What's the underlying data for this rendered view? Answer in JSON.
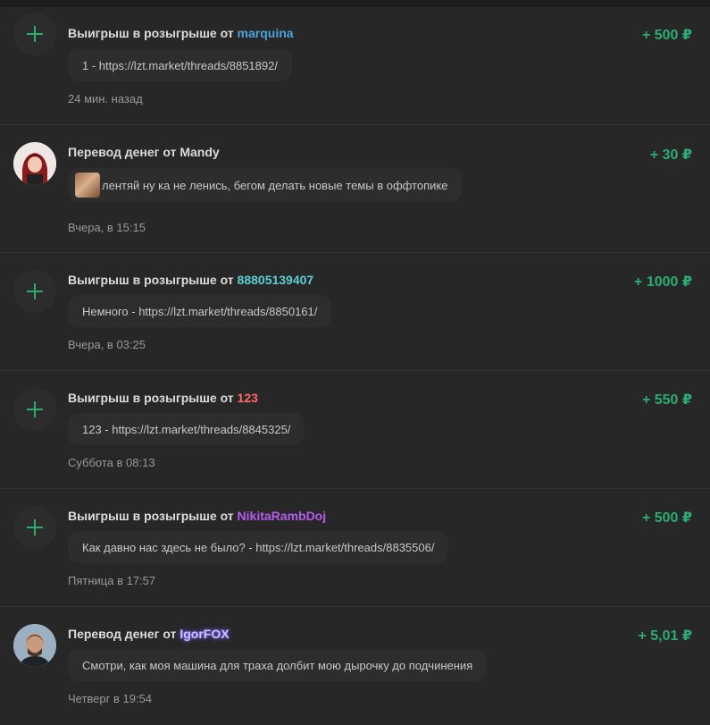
{
  "colors": {
    "accent_green": "#2bad72",
    "user_marquina": "#4aa3df",
    "user_88805139407": "#5ccfd6",
    "user_123": "#ff6b6b",
    "user_NikitaRambDoj": "#b65cf0",
    "user_IgorFOX": "#c9c2ff"
  },
  "items": [
    {
      "type": "giveaway",
      "icon": "plus-icon",
      "title_prefix": "Выигрыш в розыгрыше от",
      "user": "marquina",
      "amount": "+ 500 ₽",
      "message": "1 - https://lzt.market/threads/8851892/",
      "time": "24 мин. назад"
    },
    {
      "type": "transfer",
      "icon": "avatar-mandy",
      "title_prefix": "Перевод денег от",
      "user": "Mandy",
      "amount": "+ 30 ₽",
      "message": "лентяй ну ка не ленись, бегом делать новые темы в оффтопике",
      "time": "Вчера, в 15:15"
    },
    {
      "type": "giveaway",
      "icon": "plus-icon",
      "title_prefix": "Выигрыш в розыгрыше от",
      "user": "88805139407",
      "amount": "+ 1000 ₽",
      "message": "Немного - https://lzt.market/threads/8850161/",
      "time": "Вчера, в 03:25"
    },
    {
      "type": "giveaway",
      "icon": "plus-icon",
      "title_prefix": "Выигрыш в розыгрыше от",
      "user": "123",
      "amount": "+ 550 ₽",
      "message": "123 - https://lzt.market/threads/8845325/",
      "time": "Суббота в 08:13"
    },
    {
      "type": "giveaway",
      "icon": "plus-icon",
      "title_prefix": "Выигрыш в розыгрыше от",
      "user": "NikitaRambDoj",
      "amount": "+ 500 ₽",
      "message": "Как давно нас здесь не было? - https://lzt.market/threads/8835506/",
      "time": "Пятница в 17:57"
    },
    {
      "type": "transfer",
      "icon": "avatar-igorfox",
      "title_prefix": "Перевод денег от",
      "user": "IgorFOX",
      "amount": "+ 5,01 ₽",
      "message": "Смотри, как моя машина для траха долбит мою дырочку до подчинения",
      "time": "Четверг в 19:54"
    }
  ]
}
